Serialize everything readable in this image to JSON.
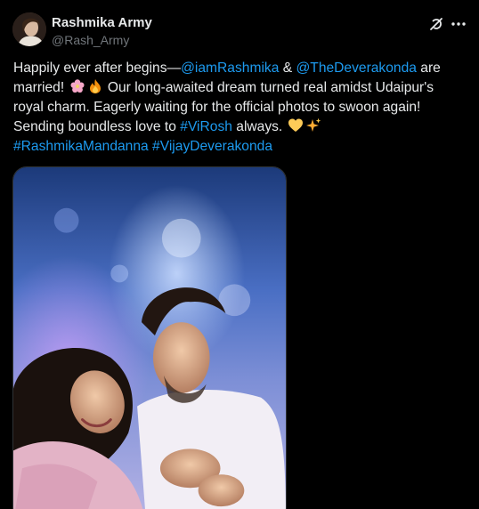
{
  "author": {
    "display_name": "Rashmika Army",
    "handle": "@Rash_Army"
  },
  "icons": {
    "grok": "grok-icon",
    "more": "more-icon",
    "flower_emoji": "cherry-blossom-emoji",
    "fire_emoji": "fire-emoji",
    "heart_emoji": "yellow-heart-emoji",
    "sparkles_emoji": "sparkles-emoji"
  },
  "post": {
    "line1_prefix": "Happily ever after begins—",
    "mention1": "@iamRashmika",
    "amp": " & ",
    "mention2": "@TheDeverakonda",
    "line1_suffix": " are",
    "line2_text": "married! ",
    "line2_rest": " Our long-awaited dream turned real amidst Udaipur's",
    "line3": "royal charm. Eagerly waiting for the official photos to swoon again!",
    "line4_prefix": "Sending boundless love to ",
    "hashtag1": "#ViRosh",
    "line4_suffix": " always. ",
    "hashtag2": "#RashmikaMandanna",
    "hashtag3": "#VijayDeverakonda"
  },
  "colors": {
    "background": "#000000",
    "text": "#e7e9ea",
    "secondary": "#71767b",
    "link": "#1d9bf0"
  }
}
